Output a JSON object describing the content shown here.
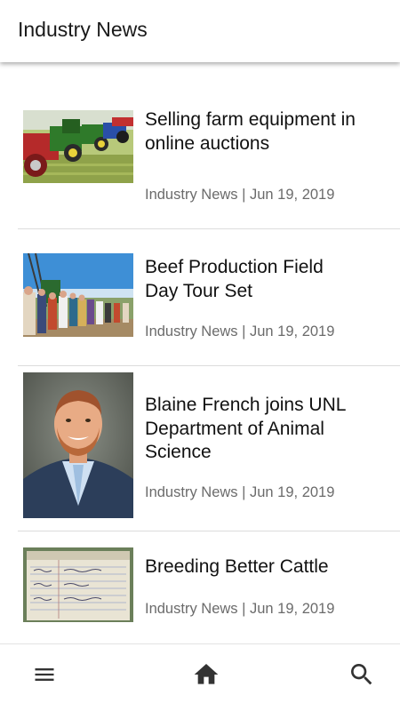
{
  "header": {
    "title": "Industry News"
  },
  "articles": [
    {
      "title": "Selling farm equipment in online auctions",
      "category": "Industry News",
      "date": "Jun 19, 2019",
      "meta": "Industry News | Jun 19, 2019"
    },
    {
      "title": "Beef Production Field Day Tour Set",
      "category": "Industry News",
      "date": "Jun 19, 2019",
      "meta": "Industry News | Jun 19, 2019"
    },
    {
      "title": "Blaine French joins UNL Department of Animal Science",
      "category": "Industry News",
      "date": "Jun 19, 2019",
      "meta": "Industry News | Jun 19, 2019"
    },
    {
      "title": "Breeding Better Cattle",
      "category": "Industry News",
      "date": "Jun 19, 2019",
      "meta": "Industry News | Jun 19, 2019"
    }
  ],
  "bottom_nav": {
    "items": [
      {
        "icon": "menu-icon"
      },
      {
        "icon": "home-icon"
      },
      {
        "icon": "search-icon"
      }
    ]
  },
  "colors": {
    "text": "#111111",
    "meta_text": "#6b6b6b",
    "divider": "#dcdcdc",
    "icon": "#333333"
  }
}
